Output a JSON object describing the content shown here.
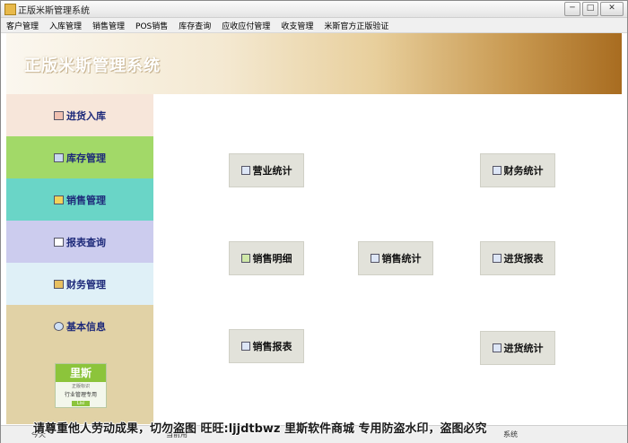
{
  "window": {
    "title": "正版米斯管理系统",
    "minimize": "─",
    "restore": "□",
    "close": "✕"
  },
  "menu": [
    "客户管理",
    "入库管理",
    "销售管理",
    "POS销售",
    "库存查询",
    "应收应付管理",
    "收支管理",
    "米斯官方正版验证"
  ],
  "banner": {
    "title": "正版米斯管理系统"
  },
  "sidebar": {
    "items": [
      {
        "label": "进货入库",
        "bg": "#f7e6da",
        "icon": "receipt-icon"
      },
      {
        "label": "库存管理",
        "bg": "#a2d968",
        "icon": "edit-icon"
      },
      {
        "label": "销售管理",
        "bg": "#6ad5c7",
        "icon": "note-icon"
      },
      {
        "label": "报表查询",
        "bg": "#ccccee",
        "icon": "report-icon"
      },
      {
        "label": "财务管理",
        "bg": "#dff0f7",
        "icon": "finance-icon"
      },
      {
        "label": "基本信息",
        "bg": "#e1d2a6",
        "icon": "search-icon"
      }
    ],
    "logo": {
      "brand": "里斯",
      "small": "正版标识",
      "tag": "行业管理专用",
      "ver": "Lisi"
    }
  },
  "functions": [
    {
      "label": "营业统计"
    },
    {
      "label": "财务统计"
    },
    {
      "label": "销售明细"
    },
    {
      "label": "销售统计"
    },
    {
      "label": "进货报表"
    },
    {
      "label": "销售报表"
    },
    {
      "label": "进货统计"
    }
  ],
  "status": {
    "left": "今天",
    "middle": "当前用",
    "right": "系统"
  },
  "watermark": "请尊重他人劳动成果，切勿盗图 旺旺:ljjdtbwz 里斯软件商城 专用防盗水印，盗图必究"
}
